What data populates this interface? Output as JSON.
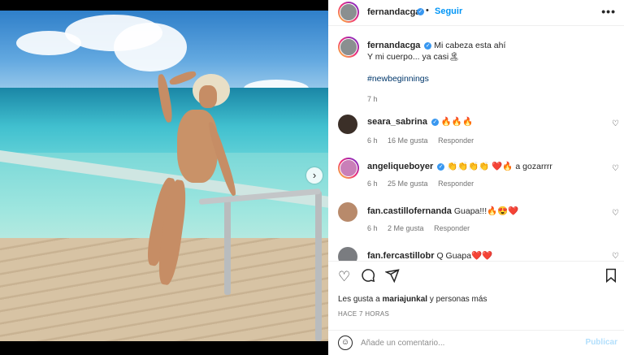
{
  "post": {
    "username": "fernandacga",
    "follow_label": "Seguir",
    "more_label": "•••",
    "caption_line1": "Mi cabeza esta ahí",
    "caption_line2": "Y mi cuerpo... ya casi🏝",
    "hashtag": "#newbeginnings",
    "caption_time": "7 h",
    "next_label": "›"
  },
  "comments": [
    {
      "username": "seara_sabrina",
      "verified": true,
      "text": "🔥🔥🔥",
      "time": "6 h",
      "likes": "16 Me gusta",
      "reply": "Responder"
    },
    {
      "username": "angeliqueboyer",
      "verified": true,
      "text": "👏👏👏👏 ❤️🔥 a gozarrrr",
      "time": "6 h",
      "likes": "25 Me gusta",
      "reply": "Responder"
    },
    {
      "username": "fan.castillofernanda",
      "verified": false,
      "text": "Guapa!!!🔥😍❤️",
      "time": "6 h",
      "likes": "2 Me gusta",
      "reply": "Responder"
    },
    {
      "username": "fan.fercastillobr",
      "verified": false,
      "text": "Q Guapa❤️❤️",
      "time": "",
      "likes": "",
      "reply": ""
    }
  ],
  "footer": {
    "likes_prefix": "Les gusta a ",
    "likes_user": "mariajunkal",
    "likes_suffix": " y personas más",
    "time_ago": "HACE 7 HORAS",
    "comment_placeholder": "Añade un comentario...",
    "publish_label": "Publicar"
  },
  "colors": {
    "accent": "#0095f6",
    "verified": "#3897f0",
    "publish_disabled": "#b2dffc"
  },
  "icons": [
    "heart-icon",
    "comment-icon",
    "share-icon",
    "bookmark-icon",
    "emoji-icon",
    "chevron-right-icon"
  ]
}
